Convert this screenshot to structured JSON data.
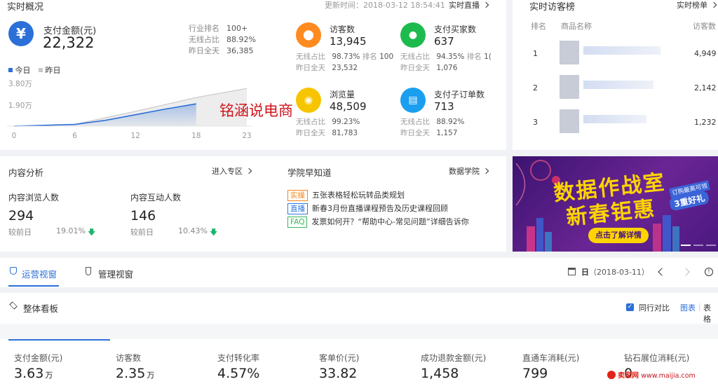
{
  "realtime": {
    "title": "实时概况",
    "update_time": "更新时间：2018-03-12 18:54:41",
    "live_link": "实时直播",
    "pay_amount_label": "支付金额(元)",
    "pay_amount": "22,322",
    "industry_rank_label": "行业排名",
    "industry_rank": "100+",
    "wireless_ratio_label": "无线占比",
    "wireless_ratio": "88.92%",
    "yesterday_full_label": "昨日全天",
    "yesterday_full": "36,385",
    "legend_today": "今日",
    "legend_yesterday": "昨日",
    "y_ticks": [
      "3.80万",
      "1.90万"
    ],
    "x_ticks": [
      "0",
      "6",
      "12",
      "18",
      "23"
    ],
    "watermark": "铭涵说电商"
  },
  "chart_data": {
    "type": "area",
    "x": [
      0,
      6,
      12,
      18,
      23
    ],
    "ylim": [
      0,
      38000
    ],
    "series": [
      {
        "name": "今日",
        "x": [
          0,
          6,
          9,
          12,
          15,
          18
        ],
        "values": [
          0,
          1500,
          5000,
          10000,
          15000,
          19500
        ]
      },
      {
        "name": "昨日",
        "x": [
          0,
          6,
          12,
          18,
          23
        ],
        "values": [
          0,
          1500,
          13000,
          25000,
          33000
        ]
      }
    ],
    "grid": false,
    "legend": "top-left"
  },
  "metrics": [
    {
      "icon": "footprint-icon",
      "color": "#ff8a1f",
      "label": "访客数",
      "value": "13,945",
      "r1_label": "无线占比",
      "r1_value": "98.73%",
      "r1_extra_label": "排名",
      "r1_extra": "100",
      "r2_label": "昨日全天",
      "r2_value": "23,532"
    },
    {
      "icon": "buyer-icon",
      "color": "#1dbb4e",
      "label": "支付买家数",
      "value": "637",
      "r1_label": "无线占比",
      "r1_value": "94.35%",
      "r1_extra_label": "排名",
      "r1_extra": "1(",
      "r2_label": "昨日全天",
      "r2_value": "1,076"
    },
    {
      "icon": "eye-icon",
      "color": "#f7c400",
      "label": "浏览量",
      "value": "48,509",
      "r1_label": "无线占比",
      "r1_value": "99.23%",
      "r2_label": "昨日全天",
      "r2_value": "81,783"
    },
    {
      "icon": "clipboard-icon",
      "color": "#1a9ef0",
      "label": "支付子订单数",
      "value": "713",
      "r1_label": "无线占比",
      "r1_value": "88.92%",
      "r2_label": "昨日全天",
      "r2_value": "1,157"
    }
  ],
  "visitors_rank": {
    "title": "实时访客榜",
    "link": "实时榜单",
    "col_rank": "排名",
    "col_name": "商品名称",
    "col_visitors": "访客数",
    "rows": [
      {
        "rank": "1",
        "visitors": "4,949"
      },
      {
        "rank": "2",
        "visitors": "2,142"
      },
      {
        "rank": "3",
        "visitors": "1,232"
      }
    ]
  },
  "content": {
    "title": "内容分析",
    "link": "进入专区",
    "browse_label": "内容浏览人数",
    "browse_value": "294",
    "browse_cmp_label": "较前日",
    "browse_cmp": "19.01%",
    "interact_label": "内容互动人数",
    "interact_value": "146",
    "interact_cmp_label": "较前日",
    "interact_cmp": "10.43%"
  },
  "academy": {
    "title": "学院早知道",
    "link": "数据学院",
    "items": [
      {
        "tag": "实操",
        "tag_color": "#f08519",
        "text": "五张表格轻松玩转品类规划"
      },
      {
        "tag": "直播",
        "tag_color": "#2f78e0",
        "text": "新春3月份直播课程预告及历史课程回顾"
      },
      {
        "tag": "FAQ",
        "tag_color": "#3bb55c",
        "text": "发票如何开？“帮助中心-常见问题”详细告诉你"
      }
    ]
  },
  "banner": {
    "line1": "数据作战室",
    "line2": "新春钜惠",
    "badge_top": "订购最高可领",
    "badge_main": "3重好礼",
    "button": "点击了解详情"
  },
  "tabs": {
    "ops": "运营视窗",
    "mgmt": "管理视窗",
    "date_prefix": "日",
    "date": "（2018-03-11）"
  },
  "board": {
    "title": "整体看板",
    "compare_label": "同行对比",
    "view_chart": "图表",
    "view_table": "表格",
    "kpis": [
      {
        "label": "支付金额(元)",
        "value": "3.63",
        "unit": "万"
      },
      {
        "label": "访客数",
        "value": "2.35",
        "unit": "万"
      },
      {
        "label": "支付转化率",
        "value": "4.57%",
        "unit": ""
      },
      {
        "label": "客单价(元)",
        "value": "33.82",
        "unit": ""
      },
      {
        "label": "成功退款金额(元)",
        "value": "1,458",
        "unit": ""
      },
      {
        "label": "直通车消耗(元)",
        "value": "799",
        "unit": ""
      },
      {
        "label": "钻石展位消耗(元)",
        "value": "0",
        "unit": ""
      }
    ]
  },
  "site_watermark": {
    "brand": "卖家网",
    "url": "www.maijia.com"
  },
  "colors": {
    "accent": "#2b6fd8",
    "banner_bg": "#5a1f86",
    "banner_yellow": "#ffd400"
  }
}
